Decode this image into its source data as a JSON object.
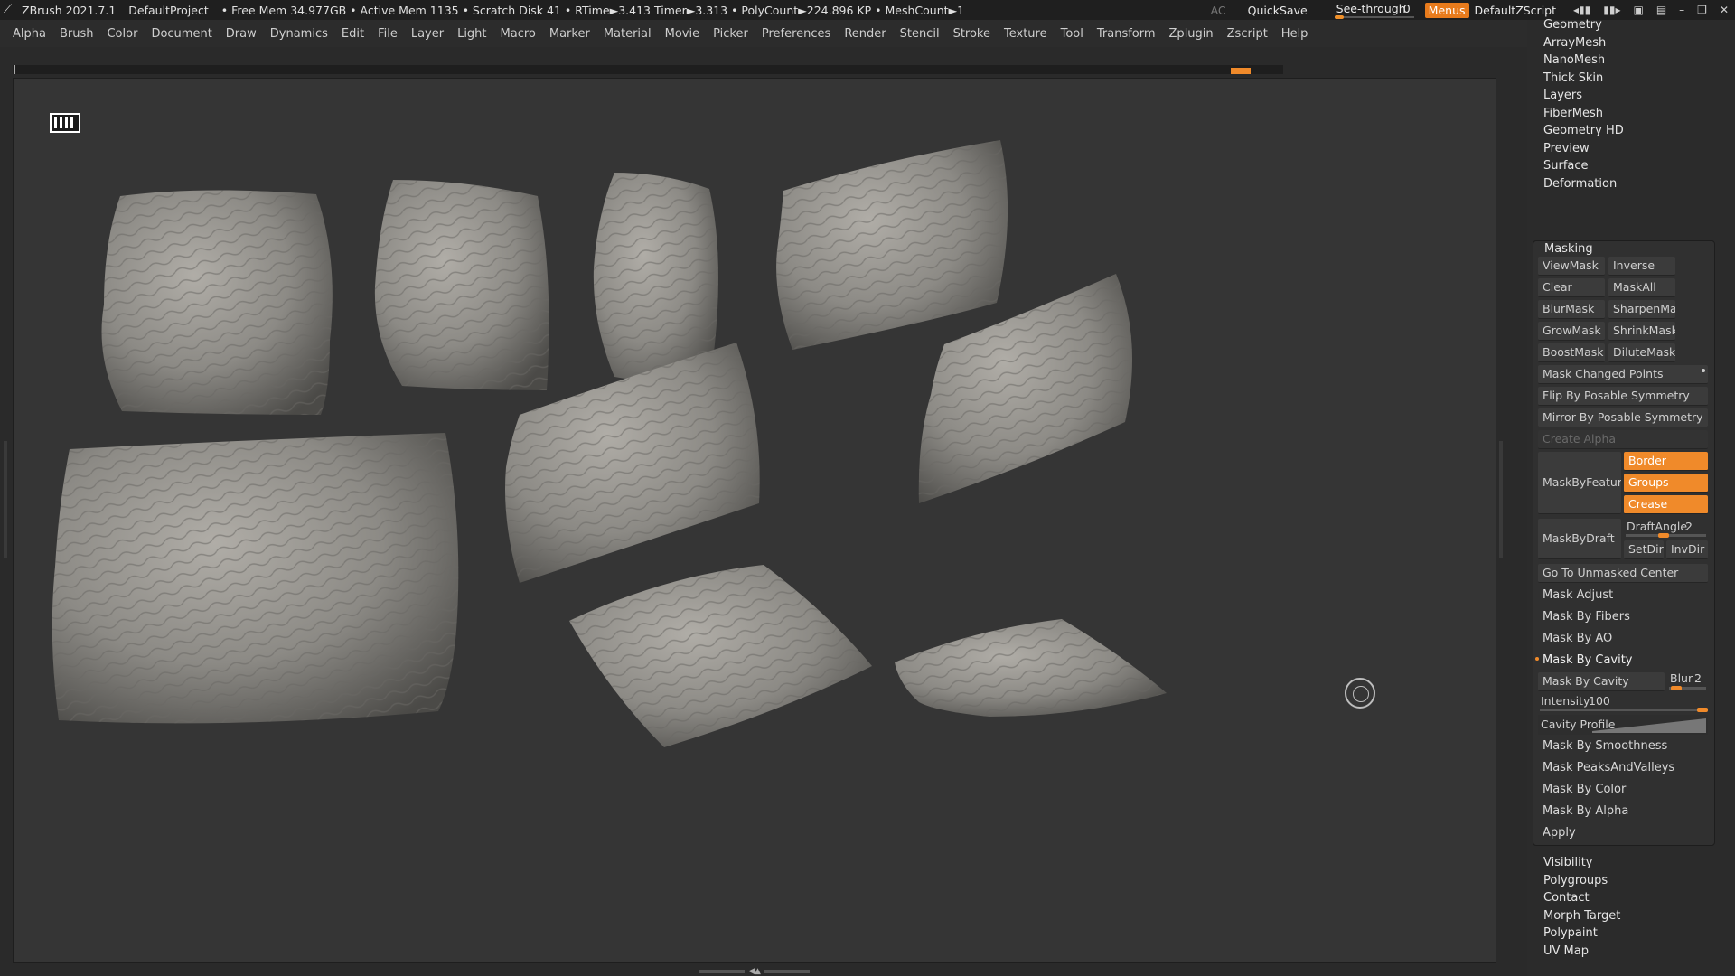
{
  "titlebar": {
    "app_name": "ZBrush 2021.7.1",
    "project": "DefaultProject",
    "status": "• Free Mem 34.977GB • Active Mem 1135 • Scratch Disk 41 •  RTime►3.413 Timer►3.313 • PolyCount►224.896 KP  • MeshCount►1",
    "ac": "AC",
    "quicksave": "QuickSave",
    "see_through_label": "See-through",
    "see_through_value": "0",
    "menus": "Menus",
    "script": "DefaultZScript"
  },
  "menubar": [
    "Alpha",
    "Brush",
    "Color",
    "Document",
    "Draw",
    "Dynamics",
    "Edit",
    "File",
    "Layer",
    "Light",
    "Macro",
    "Marker",
    "Material",
    "Movie",
    "Picker",
    "Preferences",
    "Render",
    "Stencil",
    "Stroke",
    "Texture",
    "Tool",
    "Transform",
    "Zplugin",
    "Zscript",
    "Help"
  ],
  "tool_panel": {
    "top_headers": [
      "Geometry",
      "ArrayMesh",
      "NanoMesh",
      "Thick Skin",
      "Layers",
      "FiberMesh",
      "Geometry HD",
      "Preview",
      "Surface",
      "Deformation"
    ],
    "masking": {
      "title": "Masking",
      "view_mask": "ViewMask",
      "inverse": "Inverse",
      "clear": "Clear",
      "mask_all": "MaskAll",
      "blur_mask": "BlurMask",
      "sharpen_mask": "SharpenMask",
      "grow_mask": "GrowMask",
      "shrink_mask": "ShrinkMask",
      "boost_mask": "BoostMask",
      "dilute_mask": "DiluteMask",
      "mask_changed_points": "Mask Changed Points",
      "flip_by_posable": "Flip By Posable Symmetry",
      "mirror_by_posable": "Mirror By Posable Symmetry",
      "create_alpha": "Create Alpha",
      "mask_by_feature": "MaskByFeature",
      "border": "Border",
      "groups": "Groups",
      "crease": "Crease",
      "mask_by_draft": "MaskByDraft",
      "draft_angle_label": "DraftAngle",
      "draft_angle_value": "2",
      "set_dir": "SetDir",
      "inv_dir": "InvDir",
      "go_to_unmasked": "Go To Unmasked Center",
      "mask_adjust": "Mask Adjust",
      "mask_by_fibers": "Mask By Fibers",
      "mask_by_ao": "Mask By AO",
      "mask_by_cavity_header": "Mask By Cavity",
      "mask_by_cavity_btn": "Mask By Cavity",
      "blur_label": "Blur",
      "blur_value": "2",
      "intensity_label": "Intensity",
      "intensity_value": "100",
      "cavity_profile": "Cavity Profile",
      "mask_by_smoothness": "Mask By Smoothness",
      "mask_peaks_valleys": "Mask PeaksAndValleys",
      "mask_by_color": "Mask By Color",
      "mask_by_alpha": "Mask By Alpha",
      "apply": "Apply"
    },
    "bottom_headers": [
      "Visibility",
      "Polygroups",
      "Contact",
      "Morph Target",
      "Polypaint",
      "UV Map"
    ]
  },
  "colors": {
    "accent": "#f08a2a",
    "menus_active": "#e87b1c",
    "canvas_bg": "#353535",
    "panel_bg": "#2b2b2b",
    "pillow_light": "#a8a59f",
    "pillow_dark": "#4b4a47"
  }
}
